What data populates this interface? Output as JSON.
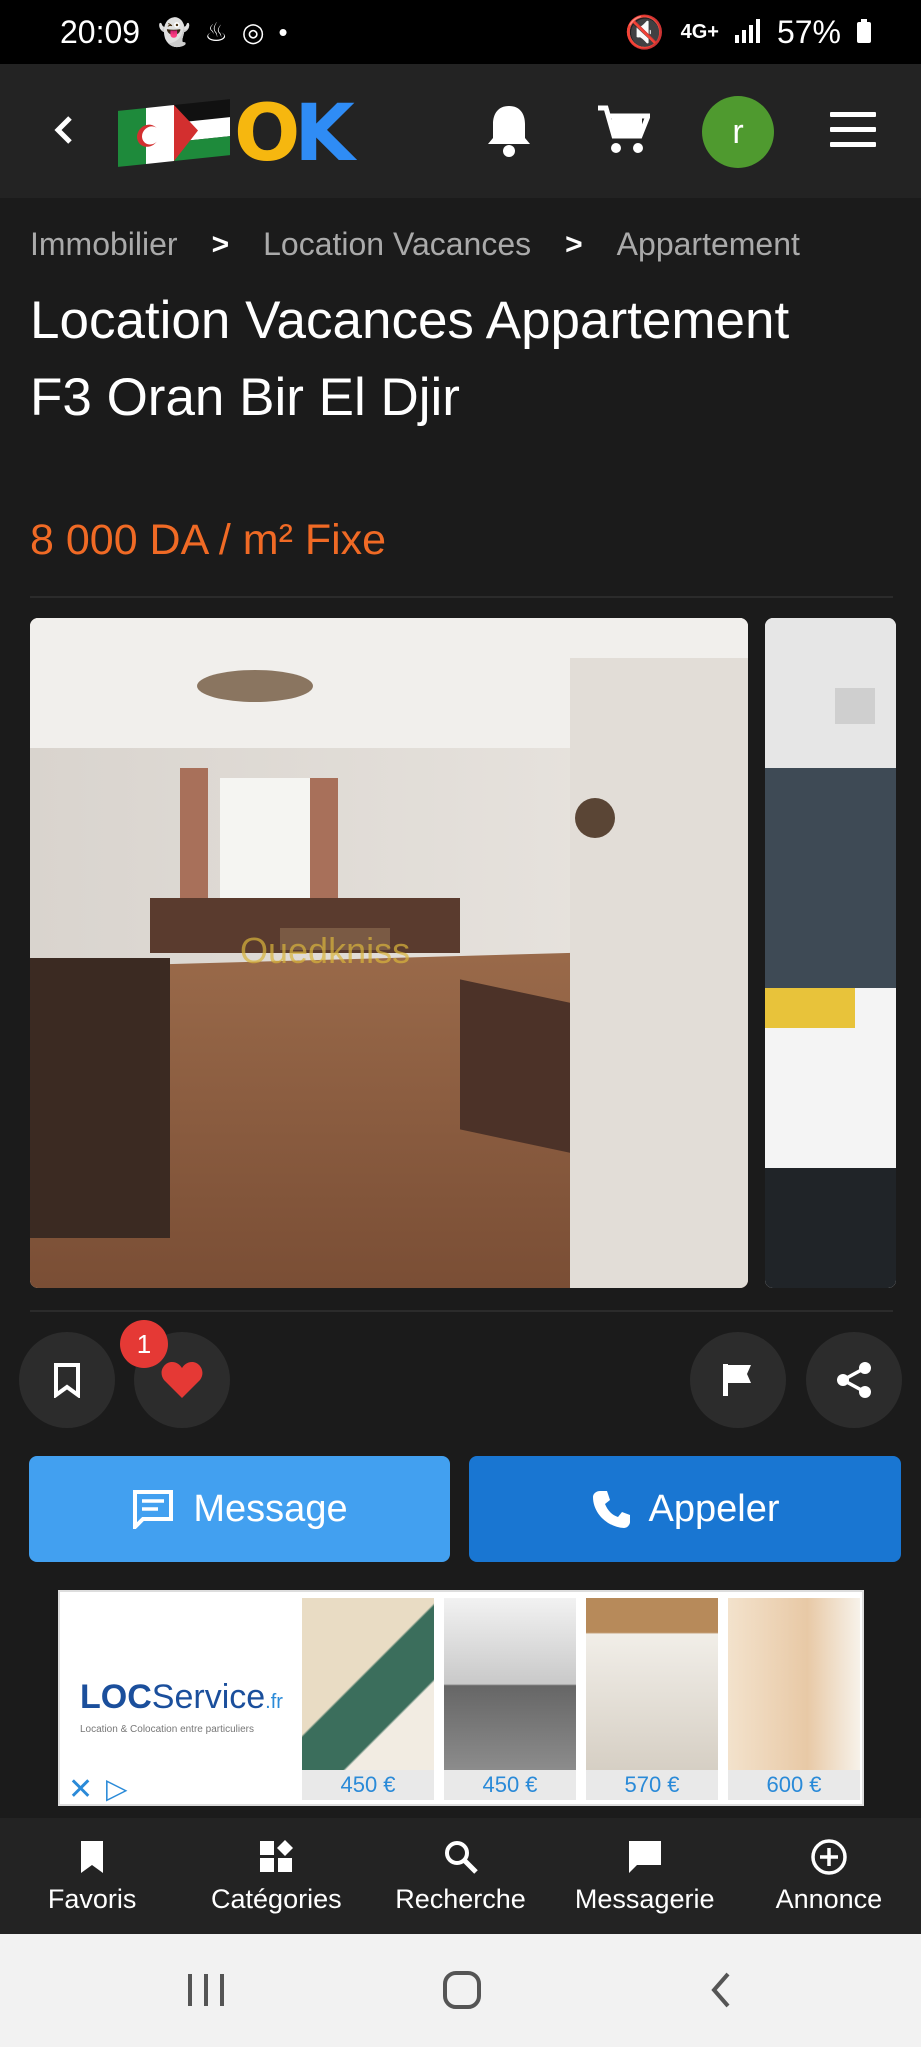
{
  "status_bar": {
    "time": "20:09",
    "network": "4G+",
    "battery": "57%"
  },
  "header": {
    "logo_text": "OK",
    "avatar_initial": "r"
  },
  "breadcrumb": [
    "Immobilier",
    "Location Vacances",
    "Appartement"
  ],
  "listing": {
    "title": "Location Vacances Appartement F3 Oran Bir El Djir",
    "price": "8 000 DA / m² Fixe",
    "watermark": "Ouedkniss"
  },
  "actions": {
    "likes_count": "1",
    "message_label": "Message",
    "call_label": "Appeler"
  },
  "ad": {
    "brand_bold": "LOC",
    "brand_rest": "Service",
    "brand_tld": ".fr",
    "tagline": "Location & Colocation entre particuliers",
    "prices": [
      "450 €",
      "450 €",
      "570 €",
      "600 €"
    ]
  },
  "bottom_nav": [
    {
      "label": "Favoris",
      "icon": "bookmark-icon"
    },
    {
      "label": "Catégories",
      "icon": "categories-icon"
    },
    {
      "label": "Recherche",
      "icon": "search-icon"
    },
    {
      "label": "Messagerie",
      "icon": "chat-icon"
    },
    {
      "label": "Annonce",
      "icon": "add-circle-icon"
    }
  ],
  "colors": {
    "price": "#f06a25",
    "message_button": "#42a0f0",
    "call_button": "#1976d2",
    "avatar": "#4f9a2f",
    "badge": "#e53935"
  }
}
